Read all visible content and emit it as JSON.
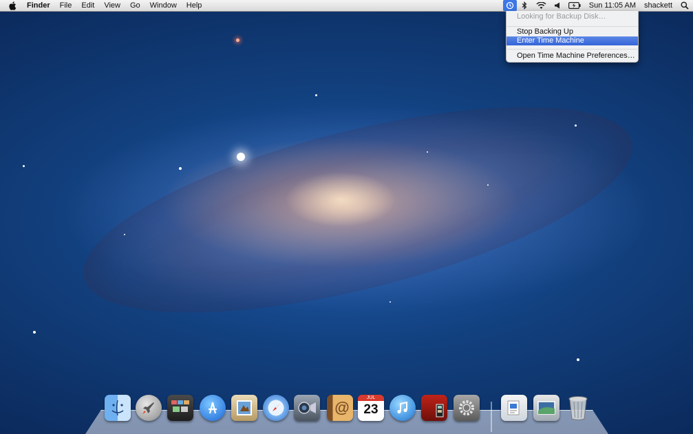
{
  "menubar": {
    "app_name": "Finder",
    "menus": [
      "File",
      "Edit",
      "View",
      "Go",
      "Window",
      "Help"
    ],
    "clock": "Sun 11:05 AM",
    "username": "shackett"
  },
  "time_machine_menu": {
    "status": "Looking for Backup Disk…",
    "items": [
      "Stop Backing Up",
      "Enter Time Machine",
      "Open Time Machine Preferences…"
    ],
    "selected": "Enter Time Machine"
  },
  "dock": {
    "calendar_month": "JUL",
    "calendar_day": "23",
    "apps": [
      "finder",
      "launchpad",
      "mission-control",
      "app-store",
      "preview",
      "safari",
      "facetime",
      "address-book",
      "ical",
      "itunes",
      "photo-booth",
      "system-preferences",
      "documents-stack",
      "downloads-stack",
      "trash"
    ]
  },
  "colors": {
    "menu_highlight": "#3464d8",
    "wallpaper_deep": "#0a2656"
  }
}
